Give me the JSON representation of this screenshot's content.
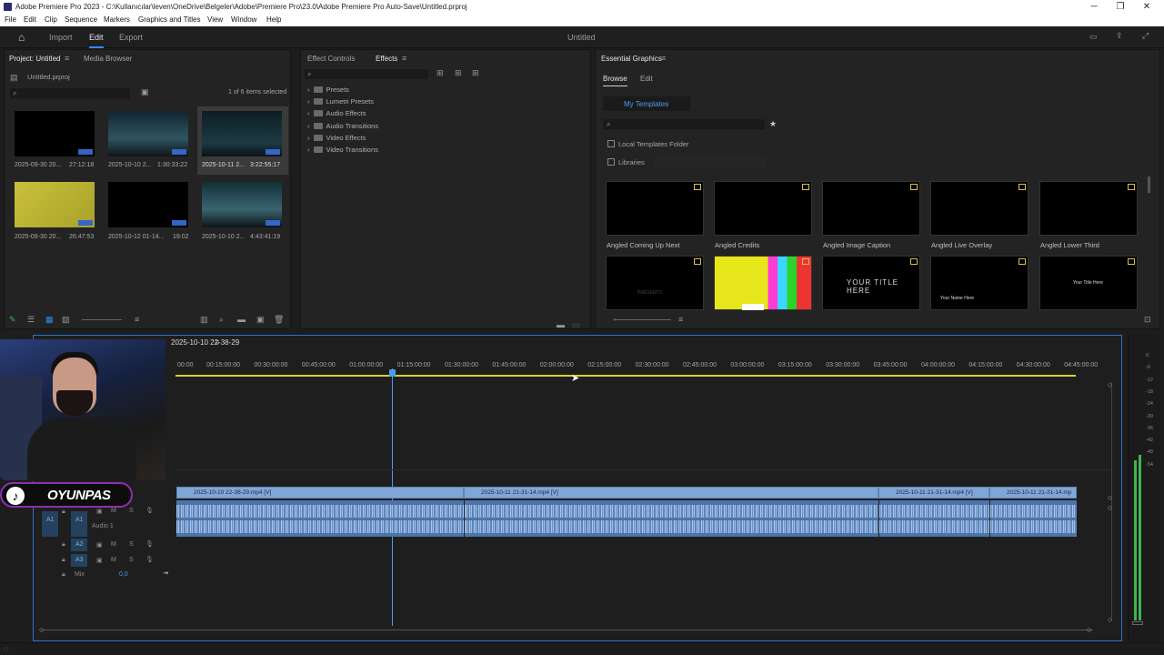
{
  "window": {
    "title": "Adobe Premiere Pro 2023 - C:\\Kullanıcılar\\leven\\OneDrive\\Belgeler\\Adobe\\Premiere Pro\\23.0\\Adobe Premiere Pro Auto-Save\\Untitled.prproj",
    "minimize": "─",
    "restore": "❐",
    "close": "✕"
  },
  "menu": [
    "File",
    "Edit",
    "Clip",
    "Sequence",
    "Markers",
    "Graphics and Titles",
    "View",
    "Window",
    "Help"
  ],
  "header": {
    "tabs": [
      "Import",
      "Edit",
      "Export"
    ],
    "active": "Edit",
    "project_name": "Untitled"
  },
  "project": {
    "tabs": [
      "Project: Untitled",
      "Media Browser"
    ],
    "file": "Untitled.prproj",
    "selection": "1 of 6 items selected",
    "items": [
      {
        "name": "2025-09-30 20...",
        "duration": "27:12:18"
      },
      {
        "name": "2025-10-10 2...",
        "duration": "1:30:33:22"
      },
      {
        "name": "2025-10-11 2...",
        "duration": "3:22:55:17"
      },
      {
        "name": "2025-09-30 20...",
        "duration": "26:47:53"
      },
      {
        "name": "2025-10-12 01-14...",
        "duration": "19:02"
      },
      {
        "name": "2025-10-10 2...",
        "duration": "4:43:41:19"
      }
    ]
  },
  "effects": {
    "tabs": [
      "Effect Controls",
      "Effects"
    ],
    "folders": [
      "Presets",
      "Lumetri Presets",
      "Audio Effects",
      "Audio Transitions",
      "Video Effects",
      "Video Transitions"
    ]
  },
  "essential_graphics": {
    "title": "Essential Graphics",
    "tabs": [
      "Browse",
      "Edit"
    ],
    "my_templates": "My Templates",
    "local_templates": "Local Templates Folder",
    "libraries": "Libraries",
    "templates": [
      "Angled Coming Up Next",
      "Angled Credits",
      "Angled Image Caption",
      "Angled Live Overlay",
      "Angled Lower Third"
    ],
    "row2_text": [
      "PRESENTS",
      "",
      "YOUR TITLE HERE",
      "Your Name Here",
      "Your Title Here"
    ]
  },
  "timeline": {
    "sequence": "2025-10-10 22-38-29",
    "ticks": [
      "00:00",
      "00:15:00:00",
      "00:30:00:00",
      "00:45:00:00",
      "01:00:00:00",
      "01:15:00:00",
      "01:30:00:00",
      "01:45:00:00",
      "02:00:00:00",
      "02:15:00:00",
      "02:30:00:00",
      "02:45:00:00",
      "03:00:00:00",
      "03:15:00:00",
      "03:30:00:00",
      "03:45:00:00",
      "04:00:00:00",
      "04:15:00:00",
      "04:30:00:00",
      "04:45:00:00"
    ],
    "video_clips": [
      "2025-10-10 22-38-29.mp4 [V]",
      "2025-10-11 21-31-14.mp4 [V]",
      "2025-10-11 21-31-14.mp4 [V]",
      "2025-10-11 21-31-14.mp"
    ],
    "tracks": {
      "a1": "A1",
      "a1_name": "Audio 1",
      "a2": "A2",
      "a3": "A3",
      "mix": "Mix",
      "mix_value": "0,0",
      "m": "M",
      "s": "S"
    },
    "meter_ticks": [
      "0",
      "-6",
      "-12",
      "-18",
      "-24",
      "-30",
      "-36",
      "-42",
      "-48",
      "-54"
    ]
  },
  "overlay": {
    "brand": "OYUNPAS"
  },
  "colors": {
    "accent": "#2d8ceb",
    "clip_video": "#7fa6d6",
    "clip_audio": "#4d74a8",
    "meter": "#3fb550",
    "badge": "#8e2fb0"
  }
}
